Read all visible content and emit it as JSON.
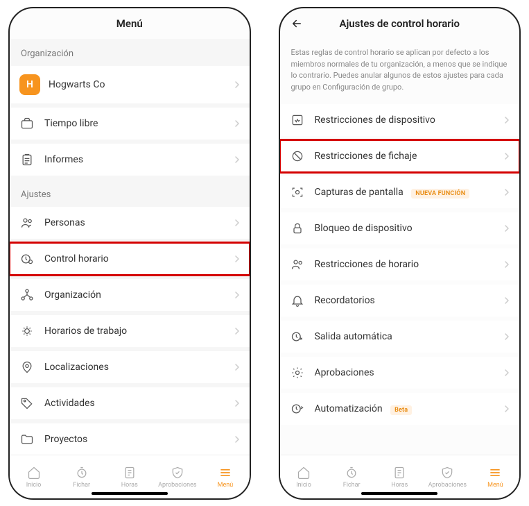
{
  "left": {
    "title": "Menú",
    "sections": {
      "org_label": "Organización",
      "settings_label": "Ajustes"
    },
    "org_name": "Hogwarts Co",
    "org_initial": "H",
    "items_org": [
      {
        "label": "Tiempo libre"
      },
      {
        "label": "Informes"
      }
    ],
    "items_settings": [
      {
        "label": "Personas"
      },
      {
        "label": "Control horario",
        "highlight": true
      },
      {
        "label": "Organización"
      },
      {
        "label": "Horarios de trabajo"
      },
      {
        "label": "Localizaciones"
      },
      {
        "label": "Actividades"
      },
      {
        "label": "Proyectos"
      }
    ]
  },
  "right": {
    "title": "Ajustes de control horario",
    "description": "Estas reglas de control horario se aplican por defecto a los miembros normales de tu organización, a menos que se indique lo contrario. Puedes anular algunos de estos ajustes para cada grupo en Configuración de grupo.",
    "items": [
      {
        "label": "Restricciones de dispositivo"
      },
      {
        "label": "Restricciones de fichaje",
        "highlight": true
      },
      {
        "label": "Capturas de pantalla",
        "badge": "NUEVA FUNCIÓN"
      },
      {
        "label": "Bloqueo de dispositivo"
      },
      {
        "label": "Restricciones de horario"
      },
      {
        "label": "Recordatorios"
      },
      {
        "label": "Salida automática"
      },
      {
        "label": "Aprobaciones"
      },
      {
        "label": "Automatización",
        "badge": "Beta"
      }
    ]
  },
  "nav": [
    {
      "label": "Inicio"
    },
    {
      "label": "Fichar"
    },
    {
      "label": "Horas"
    },
    {
      "label": "Aprobaciones"
    },
    {
      "label": "Menú",
      "active": true
    }
  ]
}
